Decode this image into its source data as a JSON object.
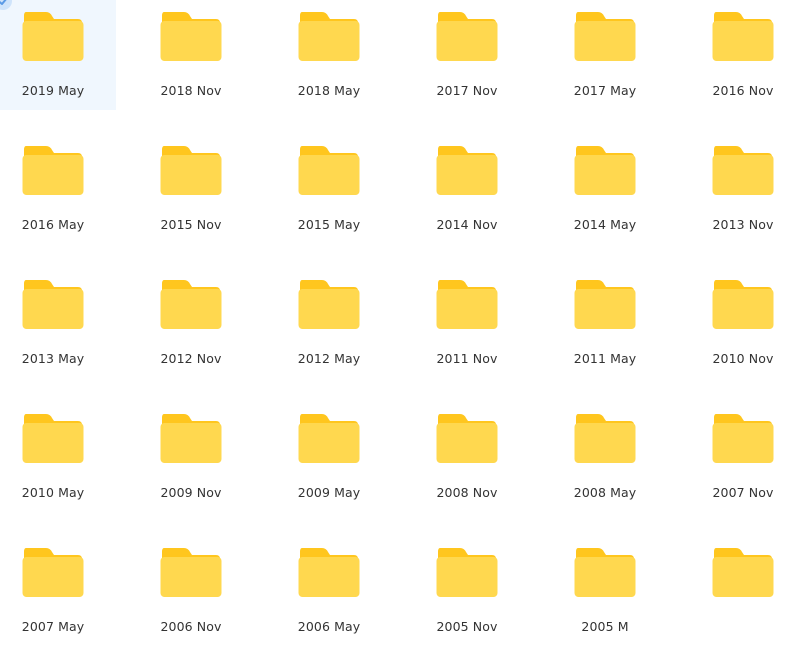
{
  "folders": [
    {
      "label": "2019 May",
      "selected": true
    },
    {
      "label": "2018 Nov"
    },
    {
      "label": "2018 May"
    },
    {
      "label": "2017 Nov"
    },
    {
      "label": "2017 May"
    },
    {
      "label": "2016 Nov"
    },
    {
      "label": "2016 May"
    },
    {
      "label": "2015 Nov"
    },
    {
      "label": "2015 May"
    },
    {
      "label": "2014 Nov"
    },
    {
      "label": "2014 May"
    },
    {
      "label": "2013 Nov"
    },
    {
      "label": "2013 May"
    },
    {
      "label": "2012 Nov"
    },
    {
      "label": "2012 May"
    },
    {
      "label": "2011 Nov"
    },
    {
      "label": "2011 May"
    },
    {
      "label": "2010 Nov"
    },
    {
      "label": "2010 May"
    },
    {
      "label": "2009 Nov"
    },
    {
      "label": "2009 May"
    },
    {
      "label": "2008 Nov"
    },
    {
      "label": "2008 May"
    },
    {
      "label": "2007 Nov"
    },
    {
      "label": "2007 May"
    },
    {
      "label": "2006 Nov"
    },
    {
      "label": "2006 May"
    },
    {
      "label": "2005 Nov"
    },
    {
      "label": "2005 M"
    },
    {
      "label": ""
    }
  ],
  "icons": {
    "folder": "folder-icon",
    "selected_check": "check-icon"
  },
  "colors": {
    "folder_body": "#FFD84F",
    "folder_tab": "#FFC61E",
    "folder_shade": "#F6C93B",
    "selected_bg": "#F0F7FE",
    "check": "#5B9BE6",
    "label": "#333333"
  }
}
